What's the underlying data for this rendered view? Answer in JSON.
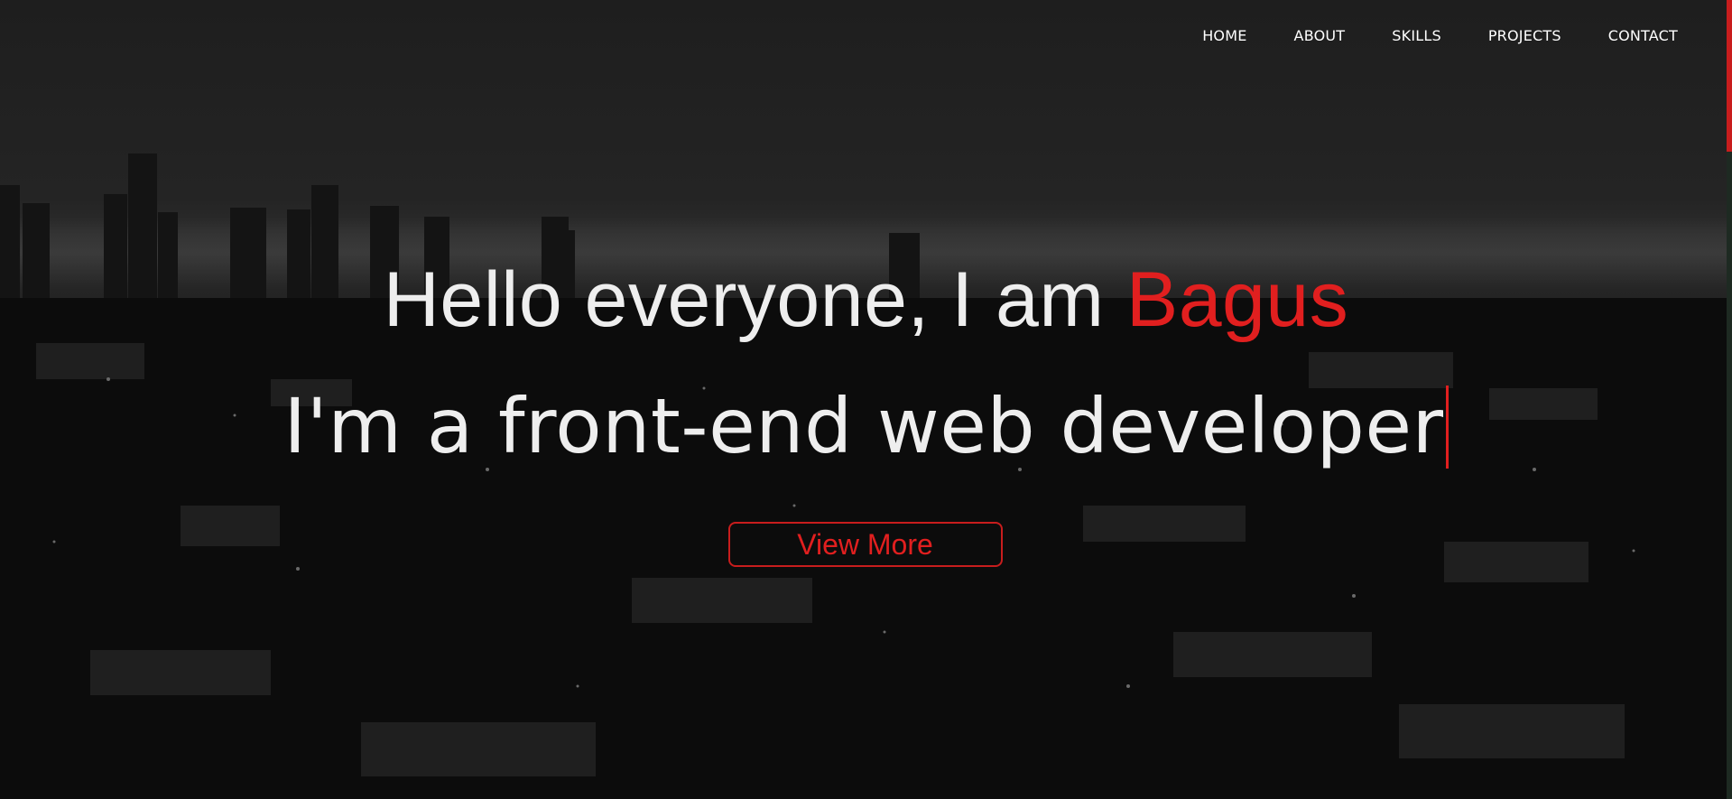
{
  "nav": {
    "items": [
      "HOME",
      "ABOUT",
      "SKILLS",
      "PROJECTS",
      "CONTACT"
    ]
  },
  "hero": {
    "greeting": "Hello everyone, I am ",
    "name": "Bagus",
    "typed_text": "I'm a front-end web developer",
    "button_label": "View More"
  },
  "colors": {
    "accent": "#e11f1f",
    "text": "#eeeeee",
    "background": "#1b1b1b"
  }
}
